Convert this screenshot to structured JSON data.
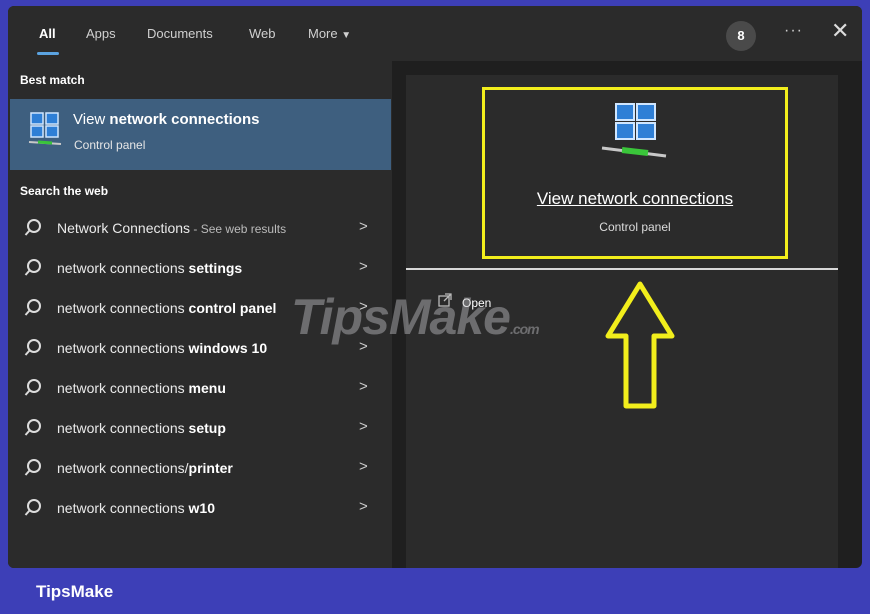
{
  "tabs": [
    {
      "label": "All"
    },
    {
      "label": "Apps"
    },
    {
      "label": "Documents"
    },
    {
      "label": "Web"
    },
    {
      "label": "More"
    }
  ],
  "header": {
    "badge": "8",
    "more_icon": "ellipsis-icon",
    "close_icon": "close-icon"
  },
  "left": {
    "best_match_heading": "Best match",
    "best_match": {
      "title_prefix": "View ",
      "title_bold": "network connections",
      "subtitle": "Control panel",
      "icon": "network-connections-icon"
    },
    "web_heading": "Search the web",
    "web_results": [
      {
        "text": "Network Connections",
        "bold": "",
        "suffix": " - See web results"
      },
      {
        "text": "network connections ",
        "bold": "settings",
        "suffix": ""
      },
      {
        "text": "network connections ",
        "bold": "control panel",
        "suffix": ""
      },
      {
        "text": "network connections ",
        "bold": "windows 10",
        "suffix": ""
      },
      {
        "text": "network connections ",
        "bold": "menu",
        "suffix": ""
      },
      {
        "text": "network connections ",
        "bold": "setup",
        "suffix": ""
      },
      {
        "text": "network connections/",
        "bold": "printer",
        "suffix": ""
      },
      {
        "text": "network connections ",
        "bold": "w10",
        "suffix": ""
      }
    ]
  },
  "preview": {
    "title": "View network connections",
    "subtitle": "Control panel",
    "open_label": "Open",
    "highlight_color": "#f2ee1c"
  },
  "watermark": {
    "main": "TipsMake",
    "suffix": ".com"
  },
  "footer": {
    "brand": "TipsMake"
  }
}
